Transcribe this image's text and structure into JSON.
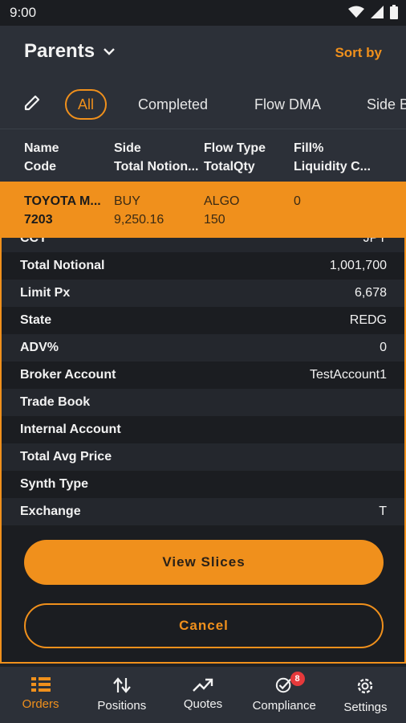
{
  "status_bar": {
    "time": "9:00"
  },
  "header": {
    "title": "Parents",
    "sort_label": "Sort by"
  },
  "filters": {
    "tabs": [
      "All",
      "Completed",
      "Flow DMA",
      "Side B"
    ]
  },
  "columns": {
    "col1": [
      "Name",
      "Code"
    ],
    "col2": [
      "Side",
      "Total Notion..."
    ],
    "col3": [
      "Flow Type",
      "TotalQty"
    ],
    "col4": [
      "Fill%",
      "Liquidity C..."
    ]
  },
  "selected_row": {
    "name": "TOYOTA M...",
    "code": "7203",
    "side": "BUY",
    "total_notional": "9,250.16",
    "flow_type": "ALGO",
    "total_qty": "150",
    "fill_pct": "0"
  },
  "details": {
    "rows": [
      {
        "label": "CCY",
        "value": "JPY"
      },
      {
        "label": "Total Notional",
        "value": "1,001,700"
      },
      {
        "label": "Limit Px",
        "value": "6,678"
      },
      {
        "label": "State",
        "value": "REDG"
      },
      {
        "label": "ADV%",
        "value": "0"
      },
      {
        "label": "Broker Account",
        "value": "TestAccount1"
      },
      {
        "label": "Trade Book",
        "value": ""
      },
      {
        "label": "Internal Account",
        "value": ""
      },
      {
        "label": "Total Avg Price",
        "value": ""
      },
      {
        "label": "Synth Type",
        "value": ""
      },
      {
        "label": "Exchange",
        "value": "T"
      }
    ],
    "view_slices_label": "View Slices",
    "cancel_label": "Cancel"
  },
  "bottom_nav": {
    "items": [
      {
        "label": "Orders",
        "icon": "orders-list-icon"
      },
      {
        "label": "Positions",
        "icon": "swap-arrows-icon"
      },
      {
        "label": "Quotes",
        "icon": "trending-up-icon"
      },
      {
        "label": "Compliance",
        "icon": "check-circle-icon",
        "badge": "8"
      },
      {
        "label": "Settings",
        "icon": "gear-icon"
      }
    ]
  },
  "colors": {
    "accent": "#f0901c",
    "background": "#1e2126",
    "panel": "#2c3038",
    "badge": "#e5393b",
    "buy": "#3c6cd6"
  }
}
